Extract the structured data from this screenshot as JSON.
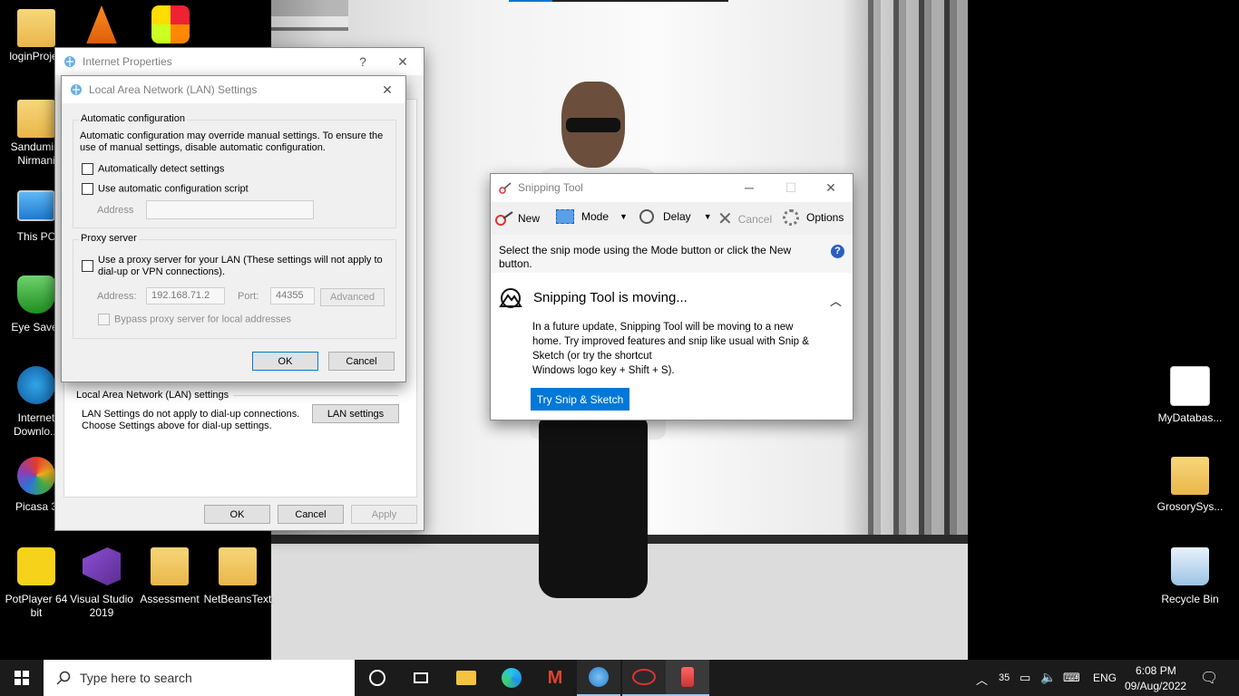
{
  "desktop": {
    "icons": [
      {
        "label": "loginProjec",
        "kind": "folder"
      },
      {
        "label": "",
        "kind": "vlc"
      },
      {
        "label": "",
        "kind": "multi"
      },
      {
        "label": "Sandumini Nirmani",
        "kind": "person-folder"
      },
      {
        "label": "This PC",
        "kind": "pc"
      },
      {
        "label": "Eye Saver",
        "kind": "shield"
      },
      {
        "label": "Internet Downlo...",
        "kind": "idm"
      },
      {
        "label": "Picasa 3",
        "kind": "picasa"
      },
      {
        "label": "PotPlayer 64 bit",
        "kind": "potplayer"
      },
      {
        "label": "Visual Studio 2019",
        "kind": "vs"
      },
      {
        "label": "Assessment",
        "kind": "pdf-folder"
      },
      {
        "label": "NetBeansText",
        "kind": "folder"
      },
      {
        "label": "MyDatabas...",
        "kind": "access"
      },
      {
        "label": "GrosorySys...",
        "kind": "folder"
      },
      {
        "label": "Recycle Bin",
        "kind": "bin"
      }
    ]
  },
  "internet_properties": {
    "title": "Internet Properties",
    "help": "?",
    "close": "✕",
    "lan_section_title": "Local Area Network (LAN) settings",
    "lan_info": "LAN Settings do not apply to dial-up connections. Choose Settings above for dial-up settings.",
    "lan_settings_btn": "LAN settings",
    "ok": "OK",
    "cancel": "Cancel",
    "apply": "Apply"
  },
  "lan_dialog": {
    "title": "Local Area Network (LAN) Settings",
    "close": "✕",
    "auto_config_title": "Automatic configuration",
    "auto_config_desc": "Automatic configuration may override manual settings.  To ensure the use of manual settings, disable automatic configuration.",
    "auto_detect": "Automatically detect settings",
    "auto_script": "Use automatic configuration script",
    "address_label": "Address",
    "address_value": "",
    "proxy_title": "Proxy server",
    "proxy_use": "Use a proxy server for your LAN (These settings will not apply to dial-up or VPN connections).",
    "proxy_address_label": "Address:",
    "proxy_address_value": "192.168.71.2",
    "port_label": "Port:",
    "port_value": "44355",
    "advanced": "Advanced",
    "bypass": "Bypass proxy server for local addresses",
    "ok": "OK",
    "cancel": "Cancel"
  },
  "snipping_tool": {
    "title": "Snipping Tool",
    "toolbar": {
      "new": "New",
      "mode": "Mode",
      "delay": "Delay",
      "cancel": "Cancel",
      "options": "Options"
    },
    "hint": "Select the snip mode using the Mode button or click the New button.",
    "moving_title": "Snipping Tool is moving...",
    "moving_body": "In a future update, Snipping Tool will be moving to a new home. Try improved features and snip like usual with Snip & Sketch (or try the shortcut",
    "moving_shortcut": "Windows logo key + Shift + S).",
    "try_btn": "Try Snip & Sketch"
  },
  "taskbar": {
    "search_placeholder": "Type here to search",
    "tray": {
      "temp": "35",
      "lang": "ENG",
      "time": "6:08 PM",
      "date": "09/Aug/2022"
    }
  },
  "colors": {
    "accent": "#0078d7",
    "taskbar": "#1b1b1b"
  }
}
